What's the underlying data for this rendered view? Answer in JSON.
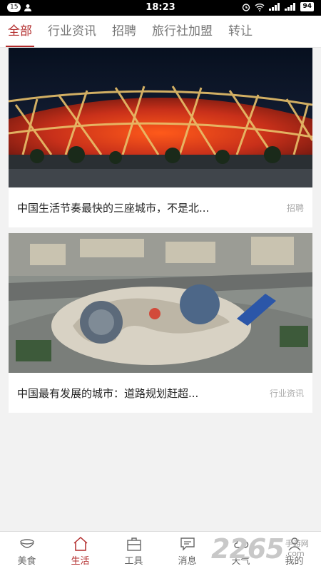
{
  "status": {
    "notif_count": "15",
    "time": "18:23",
    "battery": "94"
  },
  "tabs": [
    {
      "label": "全部"
    },
    {
      "label": "行业资讯"
    },
    {
      "label": "招聘"
    },
    {
      "label": "旅行社加盟"
    },
    {
      "label": "转让"
    }
  ],
  "articles": [
    {
      "title": "中国生活节奏最快的三座城市，不是北...",
      "category": "招聘",
      "image": "stadium-night-photo"
    },
    {
      "title": "中国最有发展的城市：道路规划赶超...",
      "category": "行业资讯",
      "image": "city-square-aerial-photo"
    }
  ],
  "nav": [
    {
      "label": "美食",
      "icon": "food-bowl-icon"
    },
    {
      "label": "生活",
      "icon": "home-icon"
    },
    {
      "label": "工具",
      "icon": "toolbox-icon"
    },
    {
      "label": "消息",
      "icon": "message-icon"
    },
    {
      "label": "天气",
      "icon": "weather-icon"
    },
    {
      "label": "我的",
      "icon": "profile-icon"
    }
  ],
  "watermark": {
    "number": "2265",
    "suffix": ".com",
    "text": "手游网"
  },
  "colors": {
    "accent": "#b22b2b",
    "background": "#f2f2f2"
  }
}
